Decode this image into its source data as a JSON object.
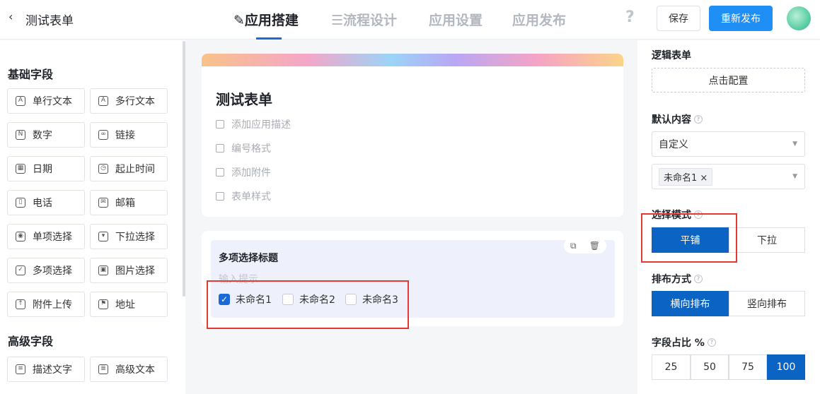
{
  "header": {
    "back_icon": "‹",
    "app_title": "测试表单",
    "tabs": [
      {
        "label": "应用搭建",
        "active": true
      },
      {
        "label": "流程设计",
        "active": false
      },
      {
        "label": "应用设置",
        "active": false
      },
      {
        "label": "应用发布",
        "active": false
      }
    ],
    "help_icon": "?",
    "save_label": "保存",
    "publish_label": "重新发布",
    "accent_color": "#1f8ff5"
  },
  "left_panel": {
    "basic_title": "基础字段",
    "basic_fields": [
      {
        "label": "单行文本",
        "icon": "A"
      },
      {
        "label": "多行文本",
        "icon": "A"
      },
      {
        "label": "数字",
        "icon": "N"
      },
      {
        "label": "链接",
        "icon": "∞"
      },
      {
        "label": "日期",
        "icon": "▦"
      },
      {
        "label": "起止时间",
        "icon": "◷"
      },
      {
        "label": "电话",
        "icon": "▯"
      },
      {
        "label": "邮箱",
        "icon": "✉"
      },
      {
        "label": "单项选择",
        "icon": "◉"
      },
      {
        "label": "下拉选择",
        "icon": "▾"
      },
      {
        "label": "多项选择",
        "icon": "✓"
      },
      {
        "label": "图片选择",
        "icon": "▣"
      },
      {
        "label": "附件上传",
        "icon": "↑"
      },
      {
        "label": "地址",
        "icon": "⚑"
      }
    ],
    "advanced_title": "高级字段",
    "advanced_fields": [
      {
        "label": "描述文字",
        "icon": "≡"
      },
      {
        "label": "高级文本",
        "icon": "≣"
      }
    ]
  },
  "canvas": {
    "form_title": "测试表单",
    "options": [
      "添加应用描述",
      "编号格式",
      "添加附件",
      "表单样式"
    ],
    "field": {
      "title": "多项选择标题",
      "hint": "输入提示",
      "choices": [
        {
          "label": "未命名1",
          "checked": true
        },
        {
          "label": "未命名2",
          "checked": false
        },
        {
          "label": "未命名3",
          "checked": false
        }
      ]
    }
  },
  "right_panel": {
    "logic_label": "逻辑表单",
    "configure_label": "点击配置",
    "default_label": "默认内容",
    "default_select": "自定义",
    "default_tag": "未命名1",
    "select_mode_label": "选择模式",
    "select_modes": [
      {
        "label": "平铺",
        "active": true
      },
      {
        "label": "下拉",
        "active": false
      }
    ],
    "layout_label": "排布方式",
    "layouts": [
      {
        "label": "横向排布",
        "active": true
      },
      {
        "label": "竖向排布",
        "active": false
      }
    ],
    "ratio_label": "字段占比 %",
    "ratios": [
      {
        "label": "25",
        "active": false
      },
      {
        "label": "50",
        "active": false
      },
      {
        "label": "75",
        "active": false
      },
      {
        "label": "100",
        "active": true
      }
    ]
  }
}
